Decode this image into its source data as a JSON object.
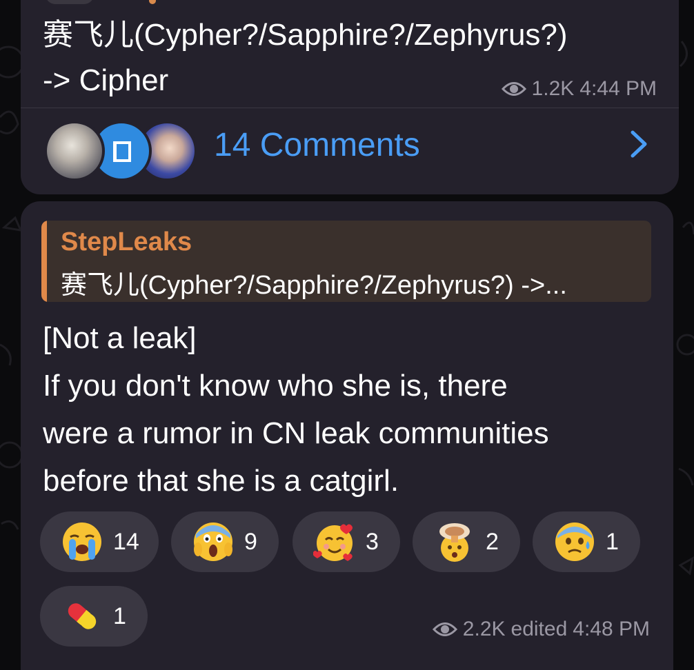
{
  "colors": {
    "bubble": "#24212c",
    "accent_link": "#4a9df5",
    "reply_accent": "#e0894a",
    "meta_text": "#9b98a4",
    "reaction_bg": "#3a3742"
  },
  "post_top": {
    "text_lines": [
      "赛飞儿(Cypher?/Sapphire?/Zephyrus?)",
      "-> Cipher"
    ],
    "views": "1.2K",
    "time": "4:44 PM",
    "views_icon": "eye-icon"
  },
  "comments": {
    "label": "14 Comments",
    "avatars": [
      "commenter-avatar-1",
      "commenter-avatar-2",
      "commenter-avatar-3"
    ],
    "chevron_icon": "chevron-right-icon"
  },
  "post_main": {
    "reply": {
      "author": "StepLeaks",
      "preview": "赛飞儿(Cypher?/Sapphire?/Zephyrus?) ->..."
    },
    "body_lines": [
      "[Not a leak]",
      "If you don't know who she is, there",
      "were a rumor in CN leak communities",
      "before that she is a catgirl."
    ],
    "reactions": [
      {
        "emoji": "loudly-crying-face-icon",
        "count": "14"
      },
      {
        "emoji": "face-screaming-in-fear-icon",
        "count": "9"
      },
      {
        "emoji": "smiling-face-with-hearts-icon",
        "count": "3"
      },
      {
        "emoji": "exploding-head-icon",
        "count": "2"
      },
      {
        "emoji": "anxious-face-with-sweat-icon",
        "count": "1"
      },
      {
        "emoji": "pill-icon",
        "count": "1"
      }
    ],
    "meta": {
      "views": "2.2K",
      "edited_label": "edited",
      "time": "4:48 PM",
      "views_icon": "eye-icon"
    }
  }
}
